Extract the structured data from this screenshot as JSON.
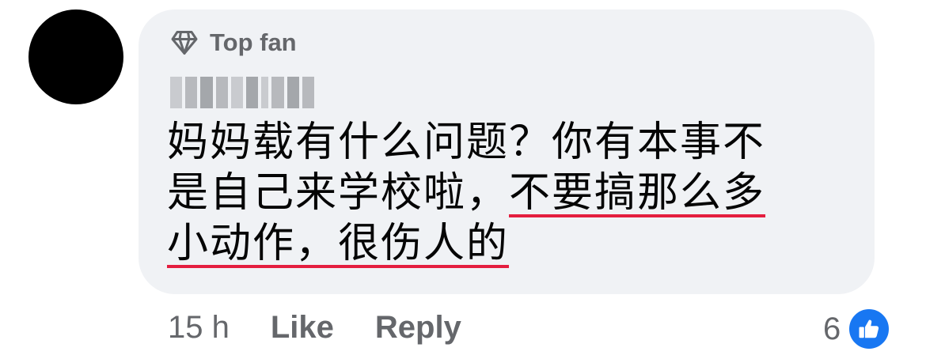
{
  "comment": {
    "badge_label": "Top fan",
    "lines": [
      {
        "text": "妈妈载有什么问题？你有本事不",
        "underlined": ""
      },
      {
        "text": "是自己来学校啦，",
        "underlined": "不要搞那么多"
      },
      {
        "text": "",
        "underlined": "小动作，很伤人的"
      }
    ]
  },
  "actions": {
    "time": "15 h",
    "like_label": "Like",
    "reply_label": "Reply"
  },
  "reactions": {
    "count": "6",
    "icon": "thumbs-up-icon"
  },
  "colors": {
    "bubble": "#f0f2f5",
    "meta_text": "#65676b",
    "underline": "#e41e3f",
    "like_blue": "#1877f2"
  }
}
